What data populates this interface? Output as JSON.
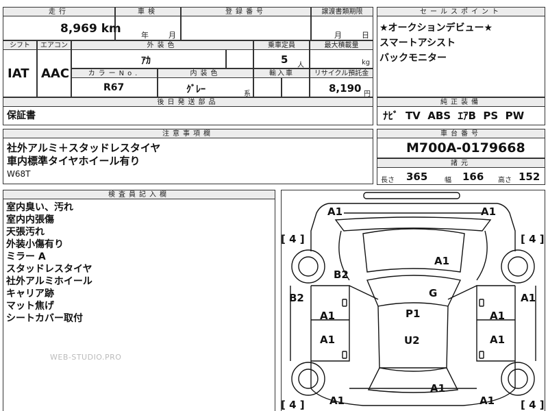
{
  "top": {
    "mileage_hdr": "走行",
    "mileage_value": "8,969 km",
    "inspection_hdr": "車検",
    "inspection_year": "年",
    "inspection_month": "月",
    "reg_hdr": "登録番号",
    "transfer_hdr": "譲渡書類期限",
    "transfer_month": "月",
    "transfer_day": "日",
    "shift_hdr": "シフト",
    "shift_value": "IAT",
    "ac_hdr": "エアコン",
    "ac_value": "AAC",
    "ext_color_hdr": "外装色",
    "ext_color_value": "ｱｶ",
    "capacity_hdr": "乗車定員",
    "capacity_value": "5",
    "capacity_unit": "人",
    "load_hdr": "最大積載量",
    "load_unit": "kg",
    "colorno_hdr": "カラーNo.",
    "colorno_value": "R67",
    "int_color_hdr": "内装色",
    "int_color_value": "ｸﾞﾚｰ",
    "int_color_suffix": "系",
    "import_hdr": "輸入車",
    "recycle_hdr": "リサイクル預託金",
    "recycle_value": "8,190",
    "recycle_unit": "円"
  },
  "sales_points": {
    "header": "セールスポイント",
    "items": [
      "★オークションデビュー★",
      "スマートアシスト",
      "バックモニター"
    ]
  },
  "shipping": {
    "header": "後日発送部品",
    "value": "保証書"
  },
  "equipment": {
    "header": "純正装備",
    "value": "ﾅﾋﾞ  TV  ABS  ｴｱB  PS  PW"
  },
  "notes": {
    "header": "注意事項欄",
    "lines": [
      "社外アルミ＋スタッドレスタイヤ",
      "車内標準タイヤホイール有り"
    ],
    "code": "W68T"
  },
  "chassis": {
    "header": "車台番号",
    "value": "M700A-0179668",
    "spec_header": "諸元",
    "length_label": "長さ",
    "length_value": "365",
    "width_label": "幅",
    "width_value": "166",
    "height_label": "高さ",
    "height_value": "152"
  },
  "inspector": {
    "header": "検査員記入欄",
    "items": [
      "室内臭い、汚れ",
      "室内内張傷",
      "天張汚れ",
      "外装小傷有り",
      "ミラー A",
      "スタッドレスタイヤ",
      "社外アルミホイール",
      "キャリア跡",
      "マット焦げ",
      "シートカバー取付"
    ]
  },
  "watermark": "WEB-STUDIO.PRO",
  "diagram": {
    "marks": {
      "a1_front_left": "A1",
      "a1_front_right": "A1",
      "bracket_tl": "[ 4 ]",
      "bracket_tr": "[ 4 ]",
      "bracket_bl": "[ 4 ]",
      "bracket_br": "[ 4 ]",
      "a1_hood": "A1",
      "b2_left_fender": "B2",
      "b2_left_side": "B2",
      "a1_right_side": "A1",
      "g_windshield": "G",
      "p1_roof": "P1",
      "u2_roof": "U2",
      "a1_left_door_front": "A1",
      "a1_left_door_rear": "A1",
      "a1_right_door_front": "A1",
      "a1_right_door_rear": "A1",
      "a1_rear_center": "A1",
      "a1_rear_left": "A1",
      "a1_rear_right": "A1"
    }
  }
}
